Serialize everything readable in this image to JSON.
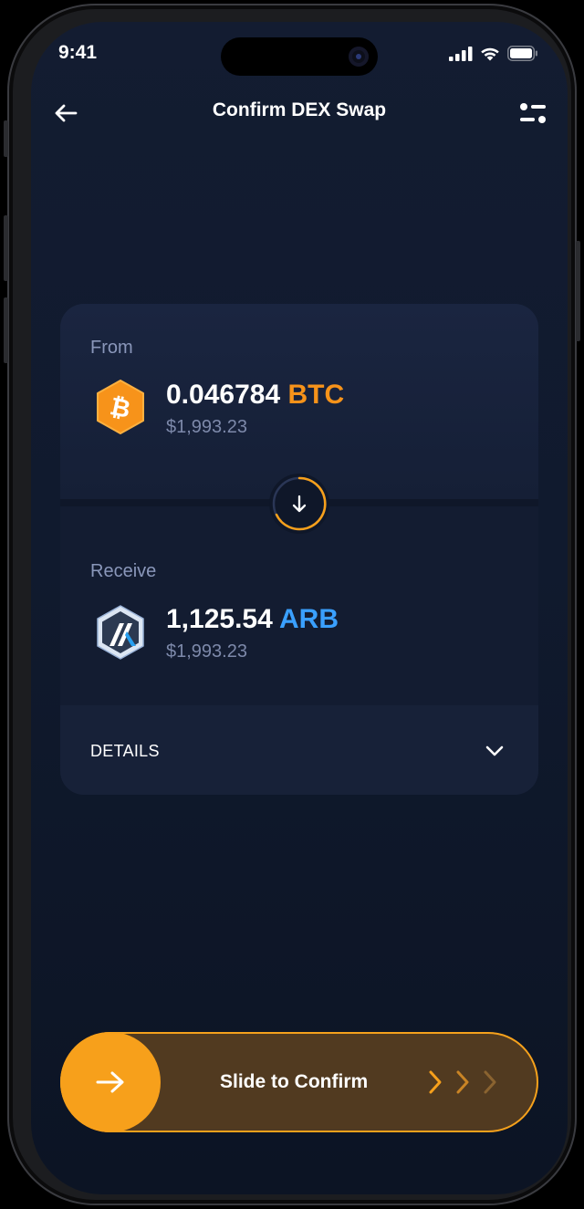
{
  "status": {
    "time": "9:41"
  },
  "header": {
    "title": "Confirm DEX Swap"
  },
  "from": {
    "label": "From",
    "amount": "0.046784",
    "symbol": "BTC",
    "fiat": "$1,993.23"
  },
  "receive": {
    "label": "Receive",
    "amount": "1,125.54",
    "symbol": "ARB",
    "fiat": "$1,993.23"
  },
  "details": {
    "label": "DETAILS"
  },
  "slider": {
    "label": "Slide to Confirm"
  },
  "colors": {
    "accent": "#f7a01b",
    "btc": "#f7931a",
    "arb": "#3aa0ff",
    "background": "#101a2e"
  },
  "icons": {
    "back": "arrow-left-icon",
    "filter": "sliders-icon",
    "swap": "arrow-down-icon",
    "details": "chevron-down-icon",
    "slider": "arrow-right-icon"
  }
}
